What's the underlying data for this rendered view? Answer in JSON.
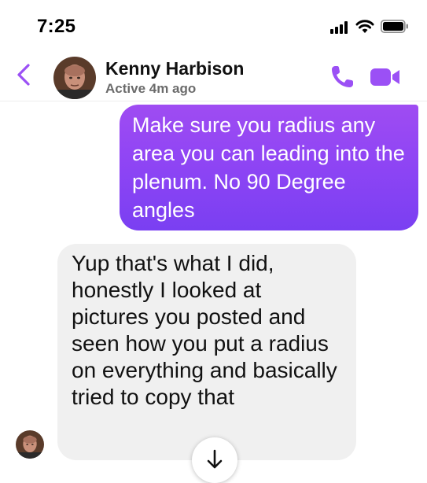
{
  "status_bar": {
    "time": "7:25"
  },
  "header": {
    "contact_name": "Kenny Harbison",
    "presence": "Active 4m ago",
    "icons": {
      "back": "chevron-left-icon",
      "call": "phone-icon",
      "video": "video-camera-icon"
    },
    "accent_color": "#9b50f5"
  },
  "messages": [
    {
      "direction": "outgoing",
      "text": "Make sure you radius any area you can leading into the plenum. No 90 Degree angles"
    },
    {
      "direction": "incoming",
      "text": "Yup that's what I did, honestly I looked at pictures you posted and seen how you put a radius on everything and basically tried to copy that"
    }
  ],
  "controls": {
    "scroll_to_bottom_icon": "arrow-down-icon"
  }
}
